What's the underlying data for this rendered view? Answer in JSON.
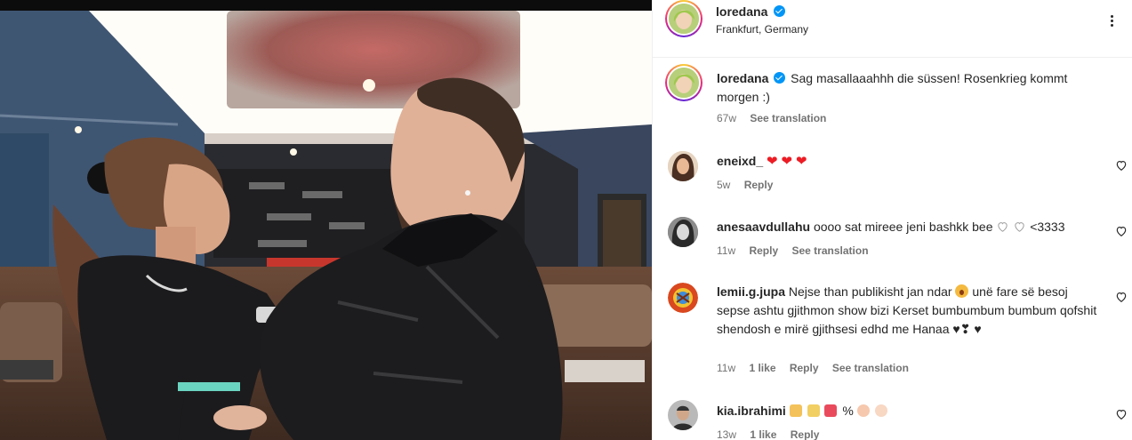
{
  "post": {
    "author": "loredana",
    "verified": true,
    "location": "Frankfurt, Germany",
    "more_icon": "more-horizontal-icon"
  },
  "comments": [
    {
      "username": "loredana",
      "verified": true,
      "text": "Sag masallaaahhh die süssen! Rosenkrieg kommt morgen :)",
      "time": "67w",
      "likes": "",
      "reply": "",
      "translate": "See translation",
      "is_caption": true
    },
    {
      "username": "eneixd_",
      "text": "",
      "emojis": [
        "red-heart",
        "red-heart",
        "red-heart"
      ],
      "time": "5w",
      "likes": "",
      "reply": "Reply",
      "translate": ""
    },
    {
      "username": "anesaavdullahu",
      "text": "oooo sat mireee jeni bashkk bee",
      "text_suffix": "<3333",
      "emojis": [
        "white-heart",
        "white-heart"
      ],
      "time": "11w",
      "likes": "",
      "reply": "Reply",
      "translate": "See translation"
    },
    {
      "username": "lemii.g.jupa",
      "text_part1": "Nejse than publikisht jan ndar",
      "text_part2": "unë fare së besoj sepse ashtu gjithmon show bizi Kerset bumbumbum bumbum qofshit shendosh e mirë gjithsesi edhd me Hanaa",
      "emojis": [
        "astonished-face",
        "black-heart",
        "heart-exclamation",
        "black-heart"
      ],
      "time": "11w",
      "likes": "1 like",
      "reply": "Reply",
      "translate": "See translation"
    },
    {
      "username": "kia.ibrahimi",
      "text": "",
      "emojis": [
        "man-bald",
        "woman-blond",
        "hundred-points",
        "percent-sign",
        "raised-hands",
        "praying-hands"
      ],
      "time": "13w",
      "likes": "1 like",
      "reply": "Reply",
      "translate": ""
    }
  ],
  "icons": {
    "like": "heart-outline-icon",
    "verified": "verified-badge-icon"
  },
  "colors": {
    "verified_blue": "#0095f6",
    "meta_gray": "#737373",
    "text": "#262626",
    "like_red": "#ed1c24"
  }
}
